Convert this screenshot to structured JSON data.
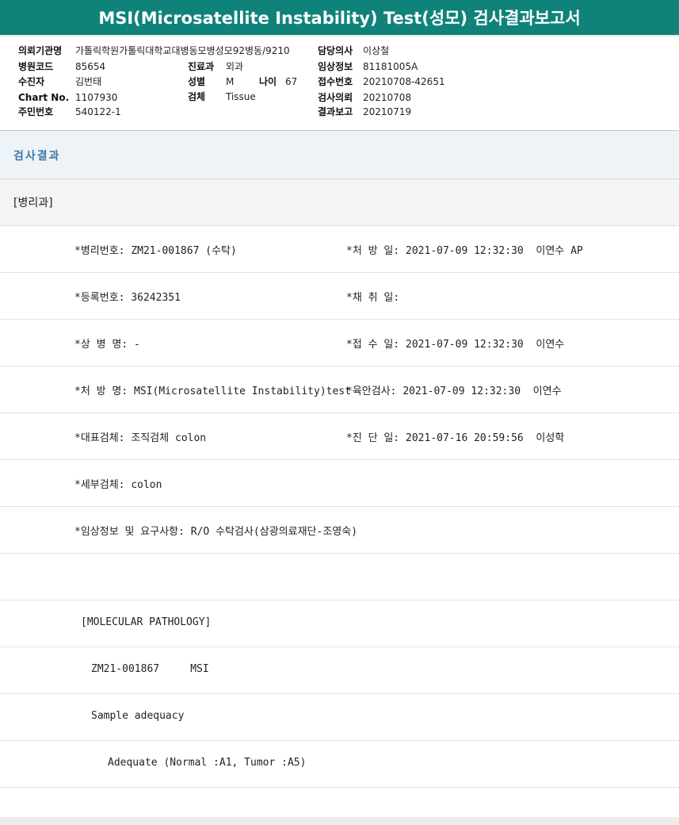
{
  "title": "MSI(Microsatellite Instability) Test(성모) 검사결과보고서",
  "info": {
    "col1": [
      {
        "label": "의뢰기관명",
        "value": "가톨릭학원가톨릭대학교대병동모병성모92병동/9210"
      },
      {
        "label": "병원코드",
        "value": "85654"
      },
      {
        "label": "수진자",
        "value": "김번태"
      },
      {
        "label": "Chart No.",
        "value": "1107930"
      },
      {
        "label": "주민번호",
        "value": "540122-1"
      }
    ],
    "col2": [
      {
        "label": "진료과",
        "value": "외과"
      },
      {
        "label": "성별",
        "value": "M"
      },
      {
        "label": "나이",
        "value": "67"
      },
      {
        "label": "검체",
        "value": "Tissue"
      }
    ],
    "col3": [
      {
        "label": "담당의사",
        "value": "이상철"
      },
      {
        "label": "임상정보",
        "value": "81181005A"
      },
      {
        "label": "접수번호",
        "value": "20210708-42651"
      },
      {
        "label": "검사의뢰",
        "value": "20210708"
      },
      {
        "label": "결과보고",
        "value": "20210719"
      }
    ]
  },
  "section_title": "검사결과",
  "department": "[병리과]",
  "rows": [
    {
      "left": "*병리번호: ZM21-001867 (수탁)",
      "right": "*처 방 일: 2021-07-09 12:32:30  이연수 AP"
    },
    {
      "left": "*등록번호: 36242351",
      "right": "*채 취 일:"
    },
    {
      "left": "*상 병 명: -",
      "right": "*접 수 일: 2021-07-09 12:32:30  이연수"
    },
    {
      "left": "*처 방 명: MSI(Microsatellite Instability)test",
      "right": "*육안검사: 2021-07-09 12:32:30  이연수"
    },
    {
      "left": "*대표검체: 조직검체 colon",
      "right": "*진 단 일: 2021-07-16 20:59:56  이성학"
    },
    {
      "left": "*세부검체: colon",
      "right": ""
    },
    {
      "left": "*임상정보 및 요구사항: R/O 수탁검사(삼광의료재단-조영숙)",
      "right": ""
    },
    {
      "left": "",
      "right": ""
    },
    {
      "left": "[MOLECULAR PATHOLOGY]",
      "right": ""
    },
    {
      "left": "ZM21-001867     MSI",
      "right": ""
    },
    {
      "left": "Sample adequacy",
      "right": ""
    },
    {
      "left": "Adequate (Normal :A1, Tumor :A5)",
      "right": ""
    }
  ]
}
